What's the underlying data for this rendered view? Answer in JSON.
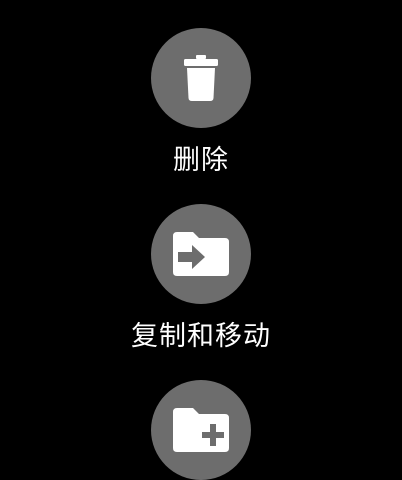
{
  "actions": [
    {
      "id": "delete",
      "label": "删除",
      "icon": "trash-icon"
    },
    {
      "id": "copy-move",
      "label": "复制和移动",
      "icon": "folder-arrow-icon"
    },
    {
      "id": "new-folder",
      "label": "",
      "icon": "folder-plus-icon"
    }
  ],
  "colors": {
    "background": "#000000",
    "button": "#6d6d6d",
    "icon": "#ffffff",
    "label": "#ffffff"
  }
}
